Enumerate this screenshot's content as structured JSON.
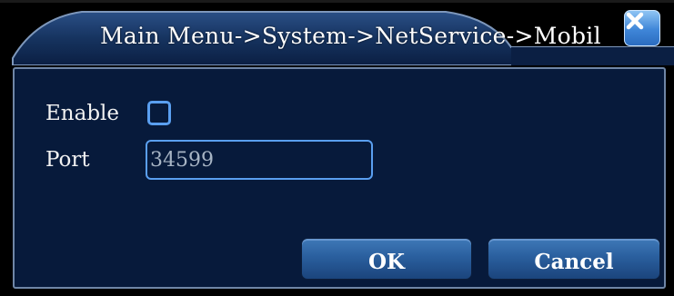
{
  "dialog": {
    "title": "Main Menu->System->NetService->Mobil",
    "close_icon": "close-icon"
  },
  "form": {
    "enable_label": "Enable",
    "enable_checked": false,
    "port_label": "Port",
    "port_value": "34599"
  },
  "buttons": {
    "ok_label": "OK",
    "cancel_label": "Cancel"
  },
  "colors": {
    "panel_bg": "#071a3b",
    "accent": "#5a9ff0",
    "close_button": "#3f86d8"
  }
}
